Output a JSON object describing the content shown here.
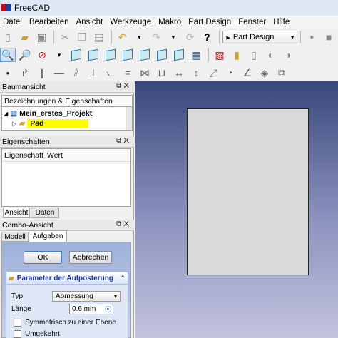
{
  "app": {
    "title": "FreeCAD"
  },
  "menu": [
    "Datei",
    "Bearbeiten",
    "Ansicht",
    "Werkzeuge",
    "Makro",
    "Part Design",
    "Fenster",
    "Hilfe"
  ],
  "toolbar": {
    "workbench": "Part Design"
  },
  "tree_panel": {
    "title": "Baumansicht",
    "header": "Bezeichnungen & Eigenschaften",
    "items": [
      {
        "label": "Mein_erstes_Projekt",
        "selected": false
      },
      {
        "label": "Pad",
        "selected": true
      }
    ]
  },
  "props_panel": {
    "title": "Eigenschaften",
    "columns": [
      "Eigenschaft",
      "Wert"
    ],
    "tabs": [
      "Ansicht",
      "Daten"
    ]
  },
  "combo_panel": {
    "title": "Combo-Ansicht",
    "tabs": [
      "Modell",
      "Aufgaben"
    ],
    "ok_label": "OK",
    "cancel_label": "Abbrechen",
    "section_title": "Parameter der Aufposterung",
    "type_label": "Typ",
    "type_value": "Abmessung",
    "length_label": "Länge",
    "length_value": "0.6 mm",
    "symmetric_label": "Symmetrisch zu einer Ebene",
    "reversed_label": "Umgekehrt"
  },
  "colors": {
    "selection": "#ffff00",
    "viewport_top": "#39477b",
    "viewport_bottom": "#c3c5de"
  }
}
